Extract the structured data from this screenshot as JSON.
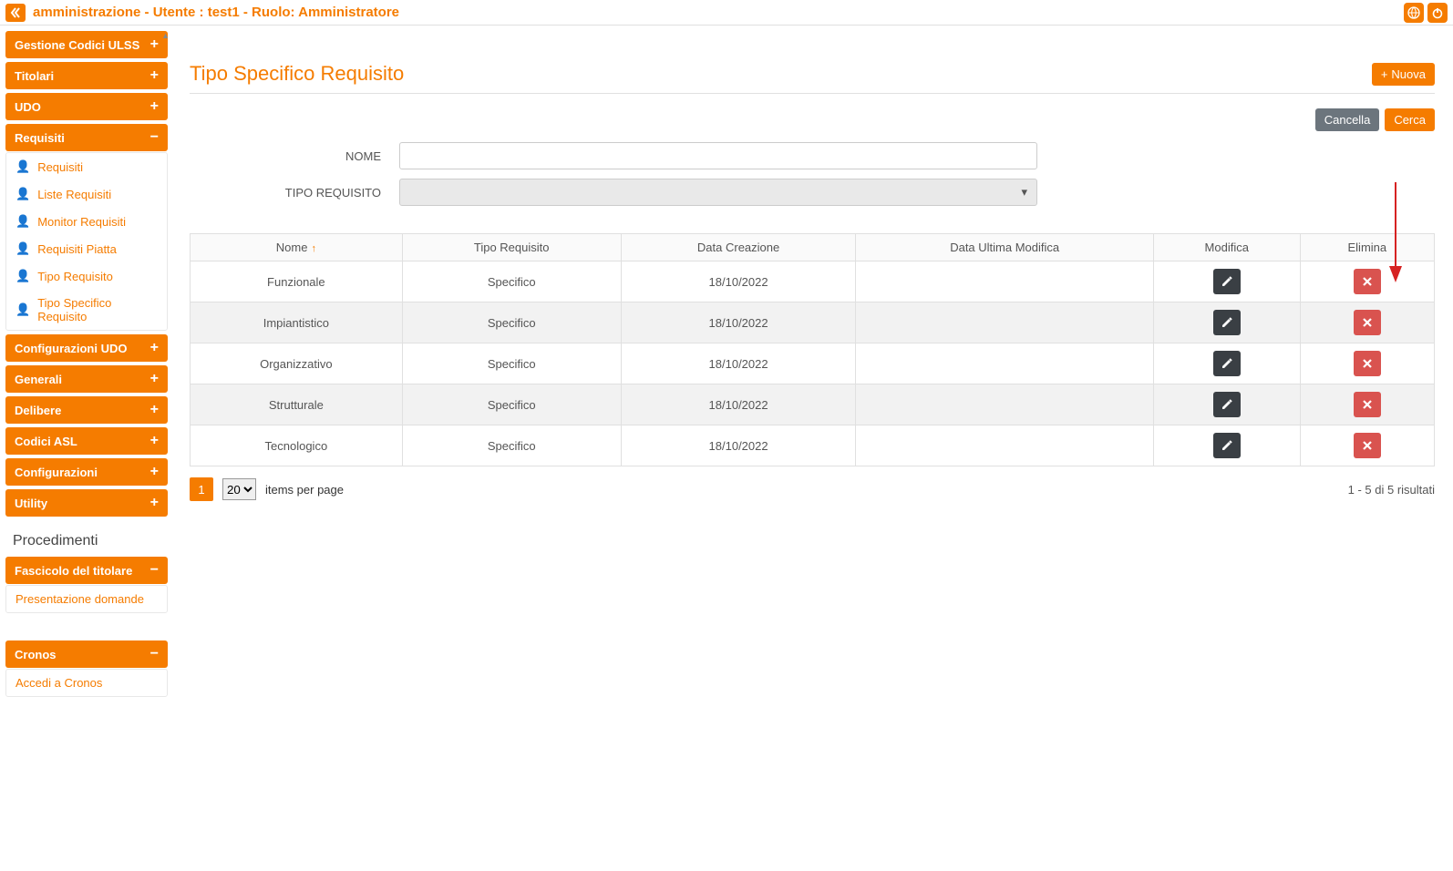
{
  "header": {
    "title": "amministrazione - Utente : test1 - Ruolo: Amministratore"
  },
  "sidebar": {
    "panels": [
      {
        "label": "Gestione Codici ULSS",
        "toggle": "+"
      },
      {
        "label": "Titolari",
        "toggle": "+"
      },
      {
        "label": "UDO",
        "toggle": "+"
      },
      {
        "label": "Requisiti",
        "toggle": "−",
        "expanded": true,
        "items": [
          "Requisiti",
          "Liste Requisiti",
          "Monitor Requisiti",
          "Requisiti Piatta",
          "Tipo Requisito",
          "Tipo Specifico Requisito"
        ]
      },
      {
        "label": "Configurazioni UDO",
        "toggle": "+"
      },
      {
        "label": "Generali",
        "toggle": "+"
      },
      {
        "label": "Delibere",
        "toggle": "+"
      },
      {
        "label": "Codici ASL",
        "toggle": "+"
      },
      {
        "label": "Configurazioni",
        "toggle": "+"
      },
      {
        "label": "Utility",
        "toggle": "+"
      }
    ],
    "section_title": "Procedimenti",
    "panels2": [
      {
        "label": "Fascicolo del titolare",
        "toggle": "−",
        "expanded": true,
        "items": [
          "Presentazione domande"
        ]
      }
    ],
    "panels3": [
      {
        "label": "Cronos",
        "toggle": "−",
        "expanded": true,
        "items": [
          "Accedi a Cronos"
        ]
      }
    ]
  },
  "main": {
    "page_title": "Tipo Specifico Requisito",
    "new_button": "Nuova",
    "cancel_button": "Cancella",
    "search_button": "Cerca",
    "form": {
      "name_label": "NOME",
      "type_label": "TIPO REQUISITO"
    },
    "table": {
      "headers": [
        "Nome",
        "Tipo Requisito",
        "Data Creazione",
        "Data Ultima Modifica",
        "Modifica",
        "Elimina"
      ],
      "rows": [
        {
          "nome": "Funzionale",
          "tipo": "Specifico",
          "data_creazione": "18/10/2022",
          "data_modifica": ""
        },
        {
          "nome": "Impiantistico",
          "tipo": "Specifico",
          "data_creazione": "18/10/2022",
          "data_modifica": ""
        },
        {
          "nome": "Organizzativo",
          "tipo": "Specifico",
          "data_creazione": "18/10/2022",
          "data_modifica": ""
        },
        {
          "nome": "Strutturale",
          "tipo": "Specifico",
          "data_creazione": "18/10/2022",
          "data_modifica": ""
        },
        {
          "nome": "Tecnologico",
          "tipo": "Specifico",
          "data_creazione": "18/10/2022",
          "data_modifica": ""
        }
      ]
    },
    "pagination": {
      "current_page": "1",
      "page_size": "20",
      "items_per_page_label": "items per page",
      "results_info": "1 - 5 di 5 risultati"
    }
  }
}
